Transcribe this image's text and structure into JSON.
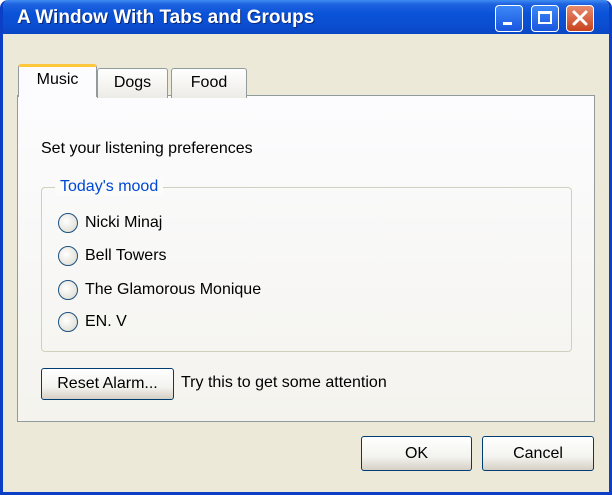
{
  "window": {
    "title": "A Window With Tabs and Groups"
  },
  "tabs": [
    {
      "label": "Music",
      "selected": true
    },
    {
      "label": "Dogs",
      "selected": false
    },
    {
      "label": "Food",
      "selected": false
    }
  ],
  "music": {
    "prefs_text": "Set your listening preferences",
    "group_title": "Today's mood",
    "options": [
      "Nicki Minaj",
      "Bell Towers",
      "The Glamorous Monique",
      "EN. V"
    ],
    "reset_label": "Reset Alarm...",
    "hint_text": "Try this to get some attention"
  },
  "footer": {
    "ok_label": "OK",
    "cancel_label": "Cancel"
  },
  "colors": {
    "titlebar": "#0A52D8",
    "group_title": "#0046D5",
    "tab_highlight": "#FFC83C",
    "close_button": "#C8421D"
  }
}
